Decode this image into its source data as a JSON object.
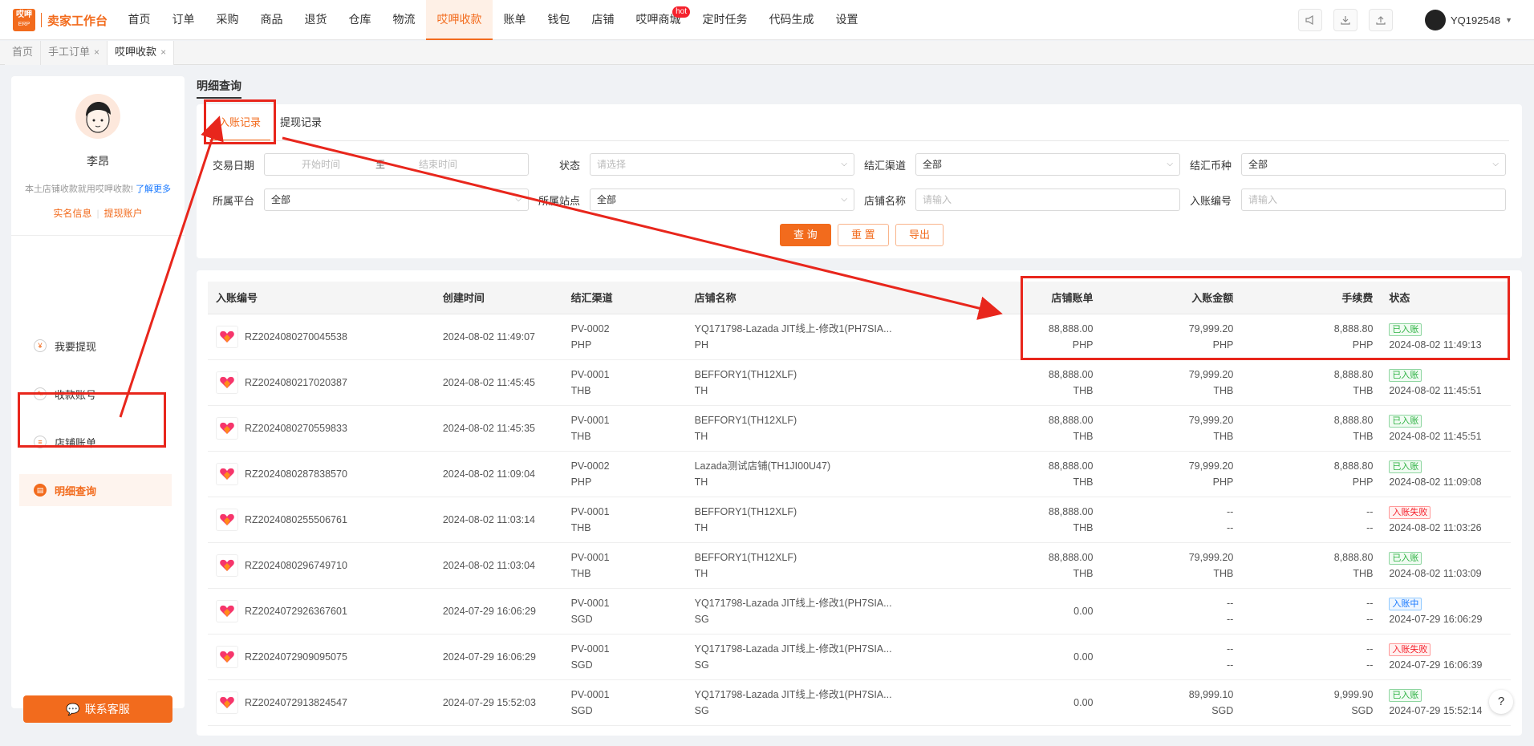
{
  "app": {
    "logo_top": "哎呷",
    "logo_bottom": "ERP",
    "title": "卖家工作台"
  },
  "nav": [
    {
      "label": "首页"
    },
    {
      "label": "订单"
    },
    {
      "label": "采购"
    },
    {
      "label": "商品"
    },
    {
      "label": "退货"
    },
    {
      "label": "仓库"
    },
    {
      "label": "物流"
    },
    {
      "label": "哎呷收款",
      "active": true
    },
    {
      "label": "账单"
    },
    {
      "label": "钱包"
    },
    {
      "label": "店铺"
    },
    {
      "label": "哎呷商城",
      "hot": "hot"
    },
    {
      "label": "定时任务"
    },
    {
      "label": "代码生成"
    },
    {
      "label": "设置"
    }
  ],
  "user": {
    "name": "YQ192548"
  },
  "tags": [
    {
      "label": "首页"
    },
    {
      "label": "手工订单",
      "close": "×"
    },
    {
      "label": "哎呷收款",
      "close": "×",
      "active": true
    }
  ],
  "profile": {
    "name": "李昂",
    "desc": "本土店铺收款就用哎呷收款!",
    "more": "了解更多",
    "link1": "实名信息",
    "link2": "提现账户"
  },
  "menu": [
    {
      "label": "我要提现",
      "icon": "¥"
    },
    {
      "label": "收款账号",
      "icon": "✎"
    },
    {
      "label": "店铺账单",
      "icon": "≡"
    },
    {
      "label": "明细查询",
      "icon": "▤",
      "active": true
    }
  ],
  "contact": {
    "label": "联系客服"
  },
  "page": {
    "title": "明细查询"
  },
  "tabs": [
    {
      "label": "入账记录",
      "active": true
    },
    {
      "label": "提现记录"
    }
  ],
  "filters": {
    "date_label": "交易日期",
    "date_start": "开始时间",
    "date_to": "至",
    "date_end": "结束时间",
    "status_label": "状态",
    "status_ph": "请选择",
    "channel_label": "结汇渠道",
    "channel_val": "全部",
    "currency_label": "结汇币种",
    "currency_val": "全部",
    "platform_label": "所属平台",
    "platform_val": "全部",
    "site_label": "所属站点",
    "site_val": "全部",
    "shop_label": "店铺名称",
    "shop_ph": "请输入",
    "no_label": "入账编号",
    "no_ph": "请输入"
  },
  "buttons": {
    "query": "查 询",
    "reset": "重 置",
    "export": "导出"
  },
  "table": {
    "headers": {
      "id": "入账编号",
      "created": "创建时间",
      "channel": "结汇渠道",
      "shop": "店铺名称",
      "bill": "店铺账单",
      "amount": "入账金额",
      "fee": "手续费",
      "status": "状态"
    },
    "rows": [
      {
        "id": "RZ2024080270045538",
        "created": "2024-08-02 11:49:07",
        "channel": "PV-0002",
        "channel_cur": "PHP",
        "shop": "YQ171798-Lazada JIT线上-修改1(PH7SIA...",
        "shop_site": "PH",
        "bill": "88,888.00",
        "bill_cur": "PHP",
        "amount": "79,999.20",
        "amount_cur": "PHP",
        "fee": "8,888.80",
        "fee_cur": "PHP",
        "status": "已入账",
        "status_type": "ok",
        "status_time": "2024-08-02 11:49:13",
        "logo": "lazada-jit"
      },
      {
        "id": "RZ2024080217020387",
        "created": "2024-08-02 11:45:45",
        "channel": "PV-0001",
        "channel_cur": "THB",
        "shop": "BEFFORY1(TH12XLF)",
        "shop_site": "TH",
        "bill": "88,888.00",
        "bill_cur": "THB",
        "amount": "79,999.20",
        "amount_cur": "THB",
        "fee": "8,888.80",
        "fee_cur": "THB",
        "status": "已入账",
        "status_type": "ok",
        "status_time": "2024-08-02 11:45:51",
        "logo": "lazada"
      },
      {
        "id": "RZ2024080270559833",
        "created": "2024-08-02 11:45:35",
        "channel": "PV-0001",
        "channel_cur": "THB",
        "shop": "BEFFORY1(TH12XLF)",
        "shop_site": "TH",
        "bill": "88,888.00",
        "bill_cur": "THB",
        "amount": "79,999.20",
        "amount_cur": "THB",
        "fee": "8,888.80",
        "fee_cur": "THB",
        "status": "已入账",
        "status_type": "ok",
        "status_time": "2024-08-02 11:45:51",
        "logo": "lazada"
      },
      {
        "id": "RZ2024080287838570",
        "created": "2024-08-02 11:09:04",
        "channel": "PV-0002",
        "channel_cur": "PHP",
        "shop": "Lazada测试店铺(TH1JI00U47)",
        "shop_site": "TH",
        "bill": "88,888.00",
        "bill_cur": "THB",
        "amount": "79,999.20",
        "amount_cur": "PHP",
        "fee": "8,888.80",
        "fee_cur": "PHP",
        "status": "已入账",
        "status_type": "ok",
        "status_time": "2024-08-02 11:09:08",
        "logo": "lazada"
      },
      {
        "id": "RZ2024080255506761",
        "created": "2024-08-02 11:03:14",
        "channel": "PV-0001",
        "channel_cur": "THB",
        "shop": "BEFFORY1(TH12XLF)",
        "shop_site": "TH",
        "bill": "88,888.00",
        "bill_cur": "THB",
        "amount": "--",
        "amount_cur": "--",
        "fee": "--",
        "fee_cur": "--",
        "status": "入账失败",
        "status_type": "fail",
        "status_time": "2024-08-02 11:03:26",
        "logo": "lazada"
      },
      {
        "id": "RZ2024080296749710",
        "created": "2024-08-02 11:03:04",
        "channel": "PV-0001",
        "channel_cur": "THB",
        "shop": "BEFFORY1(TH12XLF)",
        "shop_site": "TH",
        "bill": "88,888.00",
        "bill_cur": "THB",
        "amount": "79,999.20",
        "amount_cur": "THB",
        "fee": "8,888.80",
        "fee_cur": "THB",
        "status": "已入账",
        "status_type": "ok",
        "status_time": "2024-08-02 11:03:09",
        "logo": "lazada"
      },
      {
        "id": "RZ2024072926367601",
        "created": "2024-07-29 16:06:29",
        "channel": "PV-0001",
        "channel_cur": "SGD",
        "shop": "YQ171798-Lazada JIT线上-修改1(PH7SIA...",
        "shop_site": "SG",
        "bill": "0.00",
        "bill_cur": "",
        "amount": "--",
        "amount_cur": "--",
        "fee": "--",
        "fee_cur": "--",
        "status": "入账中",
        "status_type": "ing",
        "status_time": "2024-07-29 16:06:29",
        "logo": "lazada-jit"
      },
      {
        "id": "RZ2024072909095075",
        "created": "2024-07-29 16:06:29",
        "channel": "PV-0001",
        "channel_cur": "SGD",
        "shop": "YQ171798-Lazada JIT线上-修改1(PH7SIA...",
        "shop_site": "SG",
        "bill": "0.00",
        "bill_cur": "",
        "amount": "--",
        "amount_cur": "--",
        "fee": "--",
        "fee_cur": "--",
        "status": "入账失败",
        "status_type": "fail",
        "status_time": "2024-07-29 16:06:39",
        "logo": "lazada-jit"
      },
      {
        "id": "RZ2024072913824547",
        "created": "2024-07-29 15:52:03",
        "channel": "PV-0001",
        "channel_cur": "SGD",
        "shop": "YQ171798-Lazada JIT线上-修改1(PH7SIA...",
        "shop_site": "SG",
        "bill": "0.00",
        "bill_cur": "",
        "amount": "89,999.10",
        "amount_cur": "SGD",
        "fee": "9,999.90",
        "fee_cur": "SGD",
        "status": "已入账",
        "status_type": "ok",
        "status_time": "2024-07-29 15:52:14",
        "logo": "lazada-jit"
      }
    ]
  },
  "help": {
    "label": "?"
  },
  "colors": {
    "accent": "#f26b1d",
    "annotation": "#e8261c",
    "ok": "#2fb344",
    "fail": "#f5222d",
    "ing": "#1677ff"
  }
}
